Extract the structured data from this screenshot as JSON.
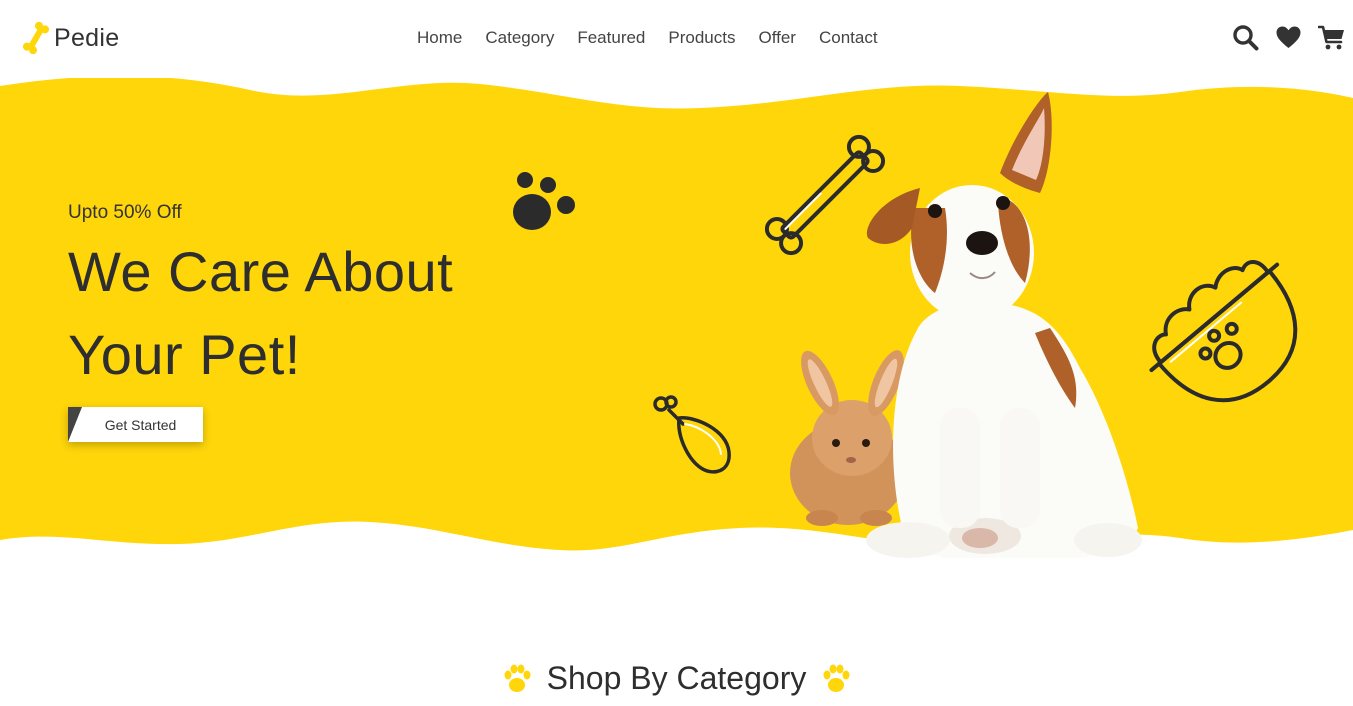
{
  "brand": {
    "name": "Pedie",
    "logo_icon": "bone-icon",
    "accent": "#FFD60A"
  },
  "nav": {
    "links": [
      "Home",
      "Category",
      "Featured",
      "Products",
      "Offer",
      "Contact"
    ],
    "icons": [
      "search-icon",
      "heart-icon",
      "cart-icon"
    ]
  },
  "hero": {
    "offer": "Upto 50% Off",
    "title_line1": "We Care About",
    "title_line2": "Your Pet!",
    "cta_label": "Get Started",
    "background_color": "#FFD60A",
    "decorations": [
      "paw-icon",
      "bone-icon",
      "chicken-leg-icon",
      "food-bowl-icon",
      "puppy-image",
      "bunny-image"
    ]
  },
  "section": {
    "title": "Shop By Category",
    "icon": "paw-icon"
  }
}
